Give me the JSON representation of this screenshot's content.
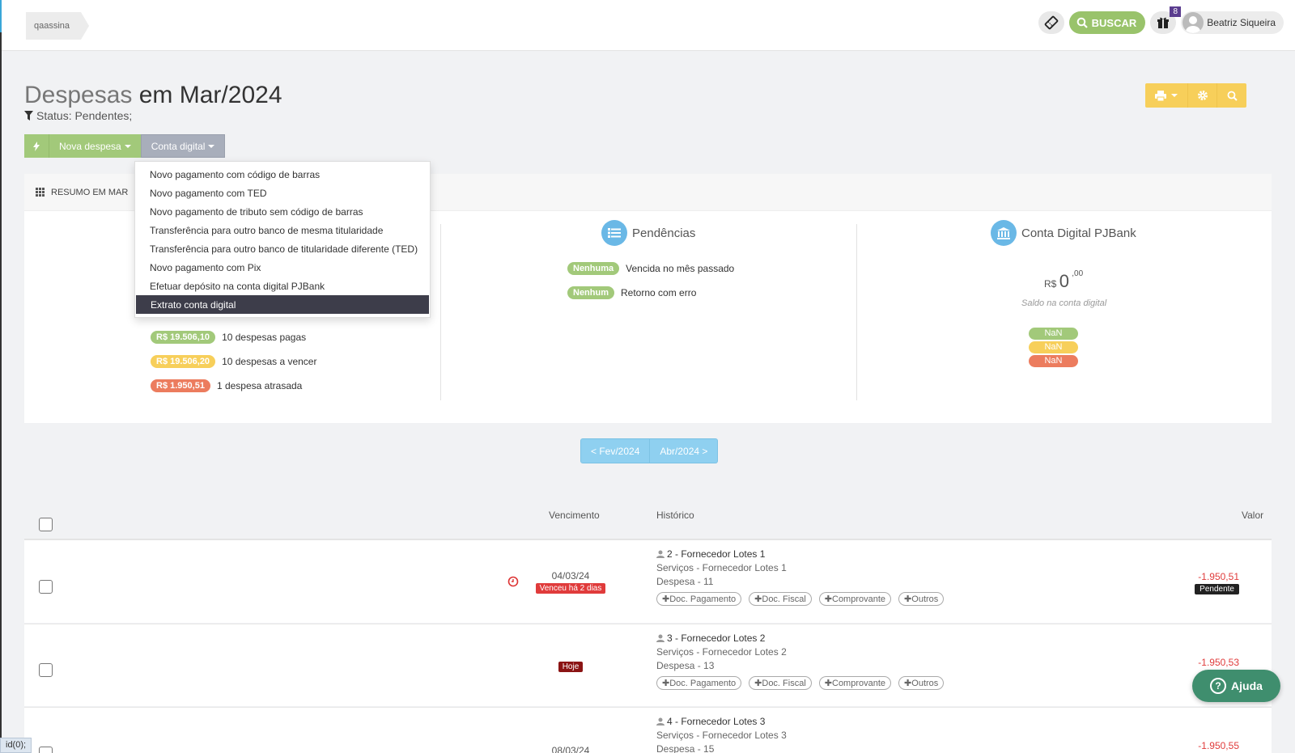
{
  "breadcrumb": "qaassina",
  "topbar": {
    "buscar_label": "BUSCAR",
    "gift_count": "8",
    "user_name": "Beatriz Siqueira"
  },
  "page": {
    "title_main": "Despesas",
    "title_rest": "em Mar/2024",
    "filter": "Status: Pendentes;"
  },
  "actions": {
    "nova_despesa": "Nova despesa",
    "conta_digital": "Conta digital"
  },
  "dropdown": {
    "items": [
      "Novo pagamento com código de barras",
      "Novo pagamento com TED",
      "Novo pagamento de tributo sem código de barras",
      "Transferência para outro banco de mesma titularidade",
      "Transferência para outro banco de titularidade diferente (TED)",
      "Novo pagamento com Pix",
      "Efetuar depósito na conta digital PJBank",
      "Extrato conta digital"
    ],
    "active_index": 7
  },
  "resumo": {
    "header": "RESUMO EM MAR",
    "items": [
      {
        "badge": "R$ 19.506,10",
        "label": "10 despesas pagas",
        "color": "#a2c97a"
      },
      {
        "badge": "R$ 19.506,20",
        "label": "10 despesas a vencer",
        "color": "#f7cf5a"
      },
      {
        "badge": "R$ 1.950,51",
        "label": "1 despesa atrasada",
        "color": "#ec7c5e"
      }
    ]
  },
  "pendencias": {
    "title": "Pendências",
    "items": [
      {
        "badge": "Nenhuma",
        "label": "Vencida no mês passado"
      },
      {
        "badge": "Nenhum",
        "label": "Retorno com erro"
      }
    ]
  },
  "conta_digital": {
    "title": "Conta Digital PJBank",
    "currency": "R$",
    "amount": "0",
    "cents": ",00",
    "subtitle": "Saldo na conta digital",
    "nan_values": [
      "NaN",
      "NaN",
      "NaN"
    ]
  },
  "pager": {
    "prev": "< Fev/2024",
    "next": "Abr/2024 >"
  },
  "table": {
    "headers": {
      "vencimento": "Vencimento",
      "historico": "Histórico",
      "valor": "Valor"
    },
    "doc_labels": [
      "Doc. Pagamento",
      "Doc. Fiscal",
      "Comprovante",
      "Outros"
    ],
    "rows": [
      {
        "title": "2 - Fornecedor Lotes 1",
        "service": "Serviços - Fornecedor Lotes 1",
        "despesa": "Despesa - 11",
        "date": "04/03/24",
        "tag": "Venceu há 2 dias",
        "valor": "-1.950,51",
        "status": "Pendente"
      },
      {
        "title": "3 - Fornecedor Lotes 2",
        "service": "Serviços - Fornecedor Lotes 2",
        "despesa": "Despesa - 13",
        "date": "",
        "tag": "Hoje",
        "valor": "-1.950,53",
        "status": ""
      },
      {
        "title": "4 - Fornecedor Lotes 3",
        "service": "Serviços - Fornecedor Lotes 3",
        "despesa": "Despesa - 15",
        "date": "08/03/24",
        "tag": "",
        "valor": "-1.950,55",
        "status": ""
      }
    ]
  },
  "ajuda": "Ajuda",
  "statusbar": "id(0);"
}
